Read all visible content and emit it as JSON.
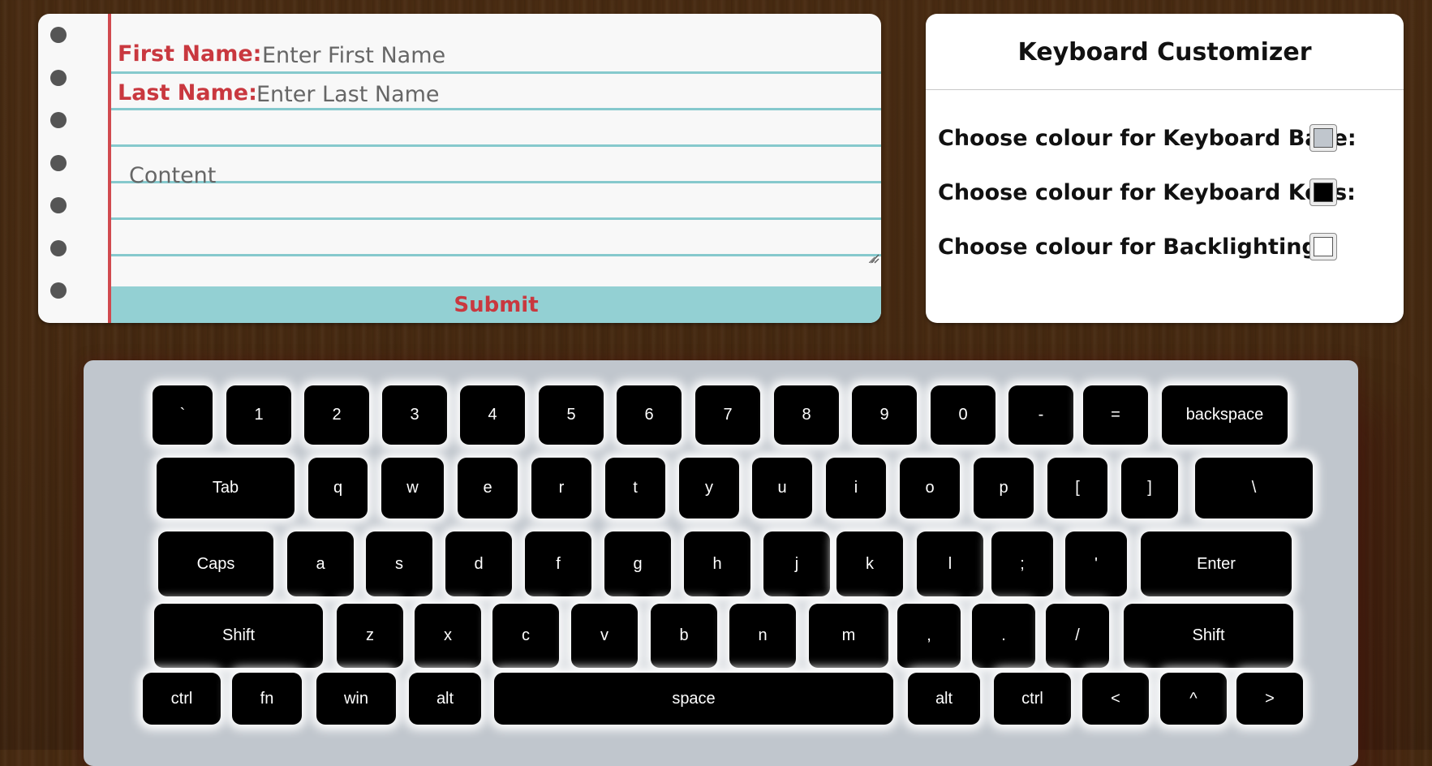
{
  "form": {
    "first_name_label": "First Name:",
    "first_name_placeholder": "Enter First Name",
    "last_name_label": "Last Name:",
    "last_name_placeholder": "Enter Last Name",
    "content_placeholder": "Content",
    "submit_label": "Submit"
  },
  "customizer": {
    "title": "Keyboard Customizer",
    "base_label": "Choose colour for Keyboard Base:",
    "keys_label": "Choose colour for Keyboard Keys:",
    "backlight_label": "Choose colour for Backlighting:",
    "base_color": "#c0c6cd",
    "keys_color": "#000000",
    "backlight_color": "#ffffff"
  },
  "keyboard": {
    "rows": [
      [
        "`",
        "1",
        "2",
        "3",
        "4",
        "5",
        "6",
        "7",
        "8",
        "9",
        "0",
        "-",
        "=",
        "backspace"
      ],
      [
        "Tab",
        "q",
        "w",
        "e",
        "r",
        "t",
        "y",
        "u",
        "i",
        "o",
        "p",
        "[",
        "]",
        "\\"
      ],
      [
        "Caps",
        "a",
        "s",
        "d",
        "f",
        "g",
        "h",
        "j",
        "k",
        "l",
        ";",
        "'",
        "Enter"
      ],
      [
        "Shift",
        "z",
        "x",
        "c",
        "v",
        "b",
        "n",
        "m",
        ",",
        ".",
        "/",
        "Shift"
      ],
      [
        "ctrl",
        "fn",
        "win",
        "alt",
        "space",
        "alt",
        "ctrl",
        "<",
        "^",
        ">"
      ]
    ]
  },
  "colors": {
    "background_wood": "#472a11",
    "notebook_margin": "#d14a4f",
    "notebook_rule": "#86c9cd",
    "submit_bg": "#93d0d3",
    "label_red": "#c9383f"
  }
}
